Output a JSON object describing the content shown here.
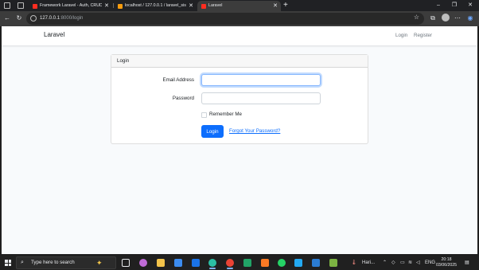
{
  "browser": {
    "tabs": [
      {
        "title": "Framework Laravel - Auth, CRUD",
        "favicon_color": "#ff2d20",
        "active": false
      },
      {
        "title": "localhost / 127.0.0.1 / laravel_sis",
        "favicon_color": "#f89c0e",
        "active": false
      },
      {
        "title": "Laravel",
        "favicon_color": "#ff2d20",
        "active": true
      }
    ],
    "new_tab": "+",
    "url_host": "127.0.0.1",
    "url_path": ":8000/login",
    "window_controls": {
      "minimize": "–",
      "maximize": "❐",
      "close": "✕"
    }
  },
  "page": {
    "brand": "Laravel",
    "nav": {
      "login": "Login",
      "register": "Register"
    },
    "card_header": "Login",
    "form": {
      "email_label": "Email Address",
      "email_value": "",
      "password_label": "Password",
      "password_value": "",
      "remember_label": "Remember Me",
      "login_button": "Login",
      "forgot_link": "Forgot Your Password?"
    }
  },
  "taskbar": {
    "search_placeholder": "Type here to search",
    "user_label": "Hari...",
    "lang": "ENG",
    "time": "20:18",
    "date": "03/06/2025",
    "apps": [
      {
        "name": "task-view",
        "color": "#e8eaed"
      },
      {
        "name": "copilot",
        "color": "#c06bd8"
      },
      {
        "name": "file-explorer",
        "color": "#f3c34a"
      },
      {
        "name": "store",
        "color": "#3c8cf0"
      },
      {
        "name": "outlook",
        "color": "#1a73e8"
      },
      {
        "name": "edge",
        "color": "#2bbfa4"
      },
      {
        "name": "chrome",
        "color": "#ea4335"
      },
      {
        "name": "excel-like",
        "color": "#21a366"
      },
      {
        "name": "xampp",
        "color": "#fb7a24"
      },
      {
        "name": "whatsapp",
        "color": "#25d366"
      },
      {
        "name": "vscode",
        "color": "#23a9f2"
      },
      {
        "name": "word",
        "color": "#2b7cd3"
      },
      {
        "name": "notepad-plus",
        "color": "#7cb342"
      }
    ]
  },
  "colors": {
    "primary": "#0d6efd",
    "page_bg": "#f8fafc",
    "focus_ring": "#86b7fe"
  }
}
